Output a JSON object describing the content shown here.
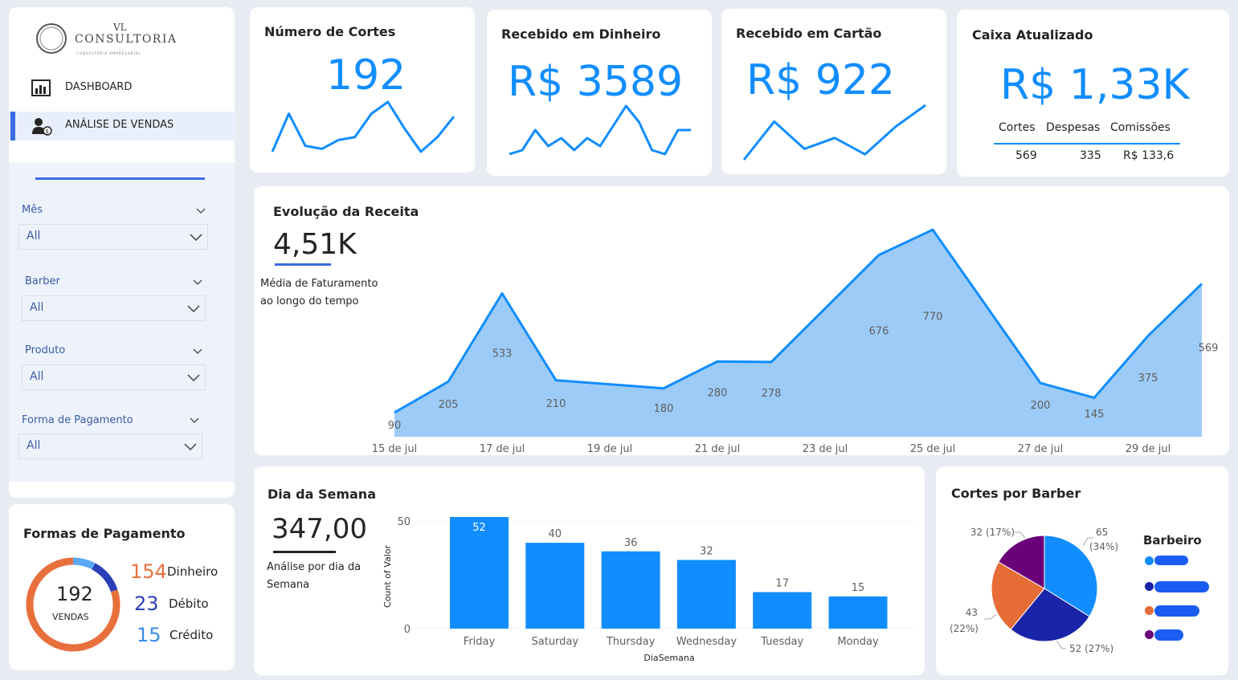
{
  "brand": {
    "line1": "VL",
    "line2": "CONSULTORIA",
    "tagline": "CONSULTORIA EMPRESARIAL"
  },
  "nav": [
    {
      "label": "DASHBOARD",
      "icon": "chart-report-icon",
      "active": false
    },
    {
      "label": "ANÁLISE DE VENDAS",
      "icon": "user-dollar-icon",
      "active": true
    }
  ],
  "filters": [
    {
      "label": "Mês",
      "value": "All"
    },
    {
      "label": "Barber",
      "value": "All"
    },
    {
      "label": "Produto",
      "value": "All"
    },
    {
      "label": "Forma de Pagamento",
      "value": "All"
    }
  ],
  "payments": {
    "title": "Formas de Pagamento",
    "total": "192",
    "total_label": "VENDAS",
    "items": [
      {
        "count": "154",
        "label": "Dinheiro",
        "color": "#e8703c"
      },
      {
        "count": "23",
        "label": "Débito",
        "color": "#2a3fb8"
      },
      {
        "count": "15",
        "label": "Crédito",
        "color": "#5ba8f5"
      }
    ]
  },
  "kpis": {
    "cortes": {
      "title": "Número de Cortes",
      "value": "192",
      "spark": [
        5,
        18,
        7,
        6,
        9,
        10,
        18,
        22,
        13,
        5,
        10,
        17
      ]
    },
    "dinheiro": {
      "title": "Recebido em Dinheiro",
      "value": "R$ 3589",
      "spark": [
        2,
        3,
        8,
        4,
        6,
        3,
        6,
        4,
        9,
        14,
        10,
        3,
        2,
        8,
        8
      ]
    },
    "cartao": {
      "title": "Recebido em Cartão",
      "value": "R$ 922",
      "spark": [
        2,
        16,
        6,
        10,
        4,
        14,
        22
      ]
    },
    "caixa": {
      "title": "Caixa Atualizado",
      "value": "R$ 1,33K",
      "headers": [
        "Cortes",
        "Despesas",
        "Comissões"
      ],
      "values": [
        "569",
        "335",
        "R$ 133,6"
      ]
    }
  },
  "revenue": {
    "title": "Evolução da Receita",
    "value": "4,51K",
    "subtitle_line1": "Média de Faturamento",
    "subtitle_line2": "ao longo do tempo",
    "ticks": [
      "15 de jul",
      "17 de jul",
      "19 de jul",
      "21 de jul",
      "23 de jul",
      "25 de jul",
      "27 de jul",
      "29 de jul"
    ]
  },
  "weekday": {
    "title": "Dia da Semana",
    "value": "347,00",
    "subtitle_line1": "Análise por dia da",
    "subtitle_line2": "Semana"
  },
  "barbers": {
    "title": "Cortes por Barber",
    "legend_title": "Barbeiro"
  },
  "chart_data": [
    {
      "type": "area",
      "title": "Evolução da Receita",
      "x": [
        "15 de jul",
        "16 de jul",
        "17 de jul",
        "18 de jul",
        "20 de jul",
        "21 de jul",
        "22 de jul",
        "24 de jul",
        "25 de jul",
        "27 de jul",
        "28 de jul",
        "29 de jul",
        "30 de jul"
      ],
      "values": [
        90,
        205,
        533,
        210,
        180,
        280,
        278,
        676,
        770,
        200,
        145,
        375,
        569
      ],
      "labels": [
        "90",
        "205",
        "533",
        "210",
        "180",
        "280",
        "278",
        "676",
        "770",
        "200",
        "145",
        "375",
        "569"
      ],
      "color": "#118dff",
      "fill": "#9ccbf7",
      "ylim": [
        0,
        800
      ]
    },
    {
      "type": "bar",
      "title": "Dia da Semana",
      "categories": [
        "Friday",
        "Saturday",
        "Thursday",
        "Wednesday",
        "Tuesday",
        "Monday"
      ],
      "values": [
        52,
        40,
        36,
        32,
        17,
        15
      ],
      "xlabel": "DiaSemana",
      "ylabel": "Count of Valor",
      "yticks": [
        "50",
        "0"
      ],
      "ylim": [
        0,
        52
      ],
      "color": "#118dff"
    },
    {
      "type": "pie",
      "title": "Cortes por Barber",
      "slices": [
        {
          "value": 65,
          "label": "65",
          "pct": "(34%)",
          "color": "#118dff"
        },
        {
          "value": 52,
          "label": "52 (27%)",
          "pct": "",
          "color": "#1a24a8"
        },
        {
          "value": 43,
          "label": "43",
          "pct": "(22%)",
          "color": "#e66c37"
        },
        {
          "value": 32,
          "label": "32 (17%)",
          "pct": "",
          "color": "#6b007b"
        }
      ]
    }
  ]
}
